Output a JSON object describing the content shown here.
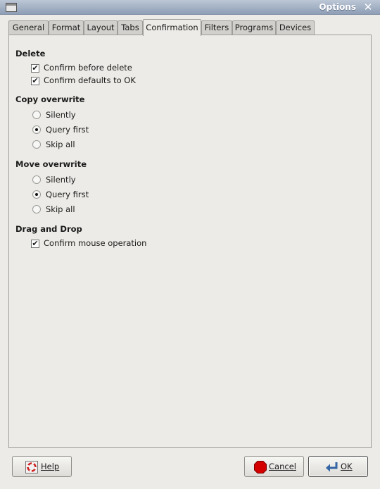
{
  "window": {
    "title": "Options"
  },
  "tabs": [
    {
      "label": "General"
    },
    {
      "label": "Format"
    },
    {
      "label": "Layout"
    },
    {
      "label": "Tabs"
    },
    {
      "label": "Confirmation",
      "active": true
    },
    {
      "label": "Filters"
    },
    {
      "label": "Programs"
    },
    {
      "label": "Devices"
    }
  ],
  "sections": {
    "delete": {
      "title": "Delete",
      "options": [
        {
          "label": "Confirm before delete",
          "checked": true
        },
        {
          "label": "Confirm defaults to OK",
          "checked": true
        }
      ]
    },
    "copy_overwrite": {
      "title": "Copy overwrite",
      "options": [
        {
          "label": "Silently",
          "selected": false
        },
        {
          "label": "Query first",
          "selected": true
        },
        {
          "label": "Skip all",
          "selected": false
        }
      ]
    },
    "move_overwrite": {
      "title": "Move overwrite",
      "options": [
        {
          "label": "Silently",
          "selected": false
        },
        {
          "label": "Query first",
          "selected": true
        },
        {
          "label": "Skip all",
          "selected": false
        }
      ]
    },
    "drag_drop": {
      "title": "Drag and Drop",
      "options": [
        {
          "label": "Confirm mouse operation",
          "checked": true
        }
      ]
    }
  },
  "buttons": {
    "help": "Help",
    "cancel": "Cancel",
    "ok": "OK"
  },
  "icons": {
    "help": "help-lifebuoy-icon",
    "cancel": "stop-sign-icon",
    "ok": "enter-arrow-icon",
    "close": "close-icon"
  },
  "colors": {
    "titlebar": "#9aa9bf",
    "background": "#ecebe7",
    "cancel_icon": "#d40000",
    "ok_icon": "#3465a4"
  }
}
